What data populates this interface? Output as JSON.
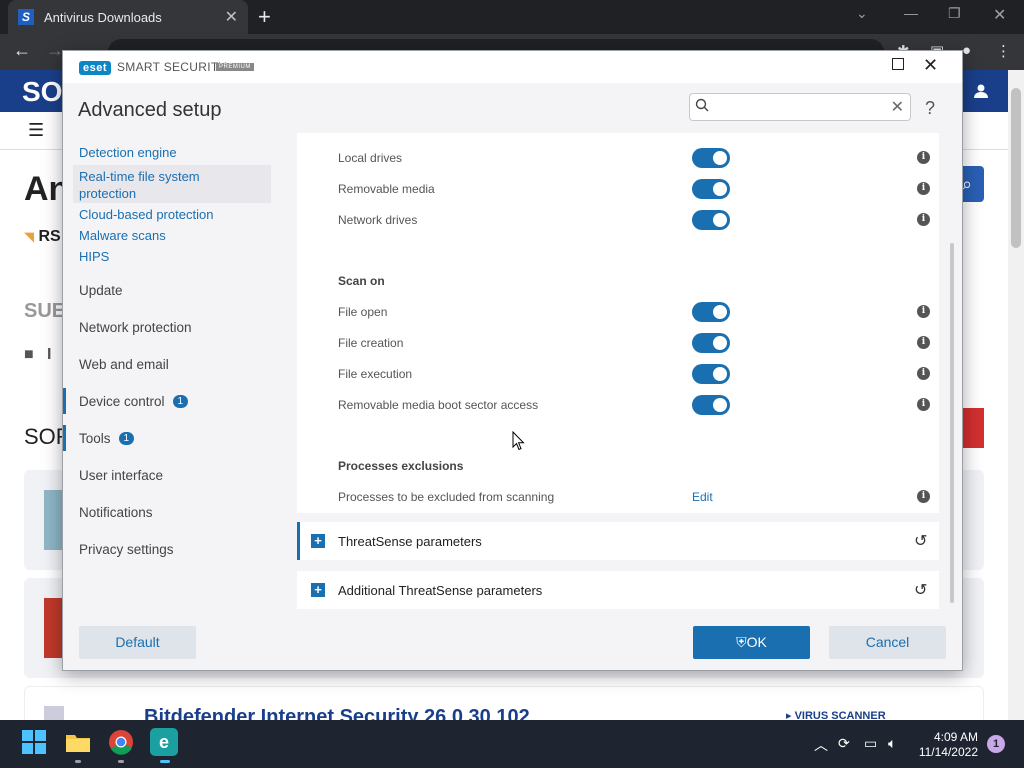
{
  "browser": {
    "tab_title": "Antivirus Downloads",
    "tab_favicon": "S"
  },
  "website": {
    "logo": "SO",
    "heading_fragment": "An",
    "rss_label": "RS",
    "sub_heading_fragment": "SUE",
    "folder_fragment": "I",
    "sort_fragment": "SOR",
    "product_title_fragment": "Bitdefender Internet Security 26.0.30.102",
    "category_tag": "VIRUS SCANNER"
  },
  "dialog": {
    "logo": "eset",
    "product": "SMART SECURITY",
    "edition": "PREMIUM",
    "title": "Advanced setup",
    "search_placeholder": "",
    "help": "?",
    "nav": [
      {
        "label": "Detection engine"
      },
      {
        "label": "Real-time file system protection"
      },
      {
        "label": "Cloud-based protection"
      },
      {
        "label": "Malware scans"
      },
      {
        "label": "HIPS"
      },
      {
        "label": "Update"
      },
      {
        "label": "Network protection"
      },
      {
        "label": "Web and email"
      },
      {
        "label": "Device control",
        "badge": "1"
      },
      {
        "label": "Tools",
        "badge": "1"
      },
      {
        "label": "User interface"
      },
      {
        "label": "Notifications"
      },
      {
        "label": "Privacy settings"
      }
    ],
    "media_rows": [
      {
        "label": "Local drives",
        "enabled": true
      },
      {
        "label": "Removable media",
        "enabled": true
      },
      {
        "label": "Network drives",
        "enabled": true
      }
    ],
    "scan_on": {
      "heading": "Scan on",
      "rows": [
        {
          "label": "File open",
          "enabled": true
        },
        {
          "label": "File creation",
          "enabled": true
        },
        {
          "label": "File execution",
          "enabled": true
        },
        {
          "label": "Removable media boot sector access",
          "enabled": true
        }
      ]
    },
    "processes": {
      "heading": "Processes exclusions",
      "label": "Processes to be excluded from scanning",
      "action": "Edit"
    },
    "sections": [
      {
        "label": "ThreatSense parameters"
      },
      {
        "label": "Additional ThreatSense parameters"
      }
    ],
    "buttons": {
      "default": "Default",
      "ok": "OK",
      "cancel": "Cancel"
    }
  },
  "taskbar": {
    "time": "4:09 AM",
    "date": "11/14/2022",
    "notification_count": "1"
  },
  "colors": {
    "eset_blue": "#1a6fb0",
    "toggle_on": "#1a6fb0",
    "site_header": "#1a3f8a",
    "taskbar": "#1f2530"
  }
}
